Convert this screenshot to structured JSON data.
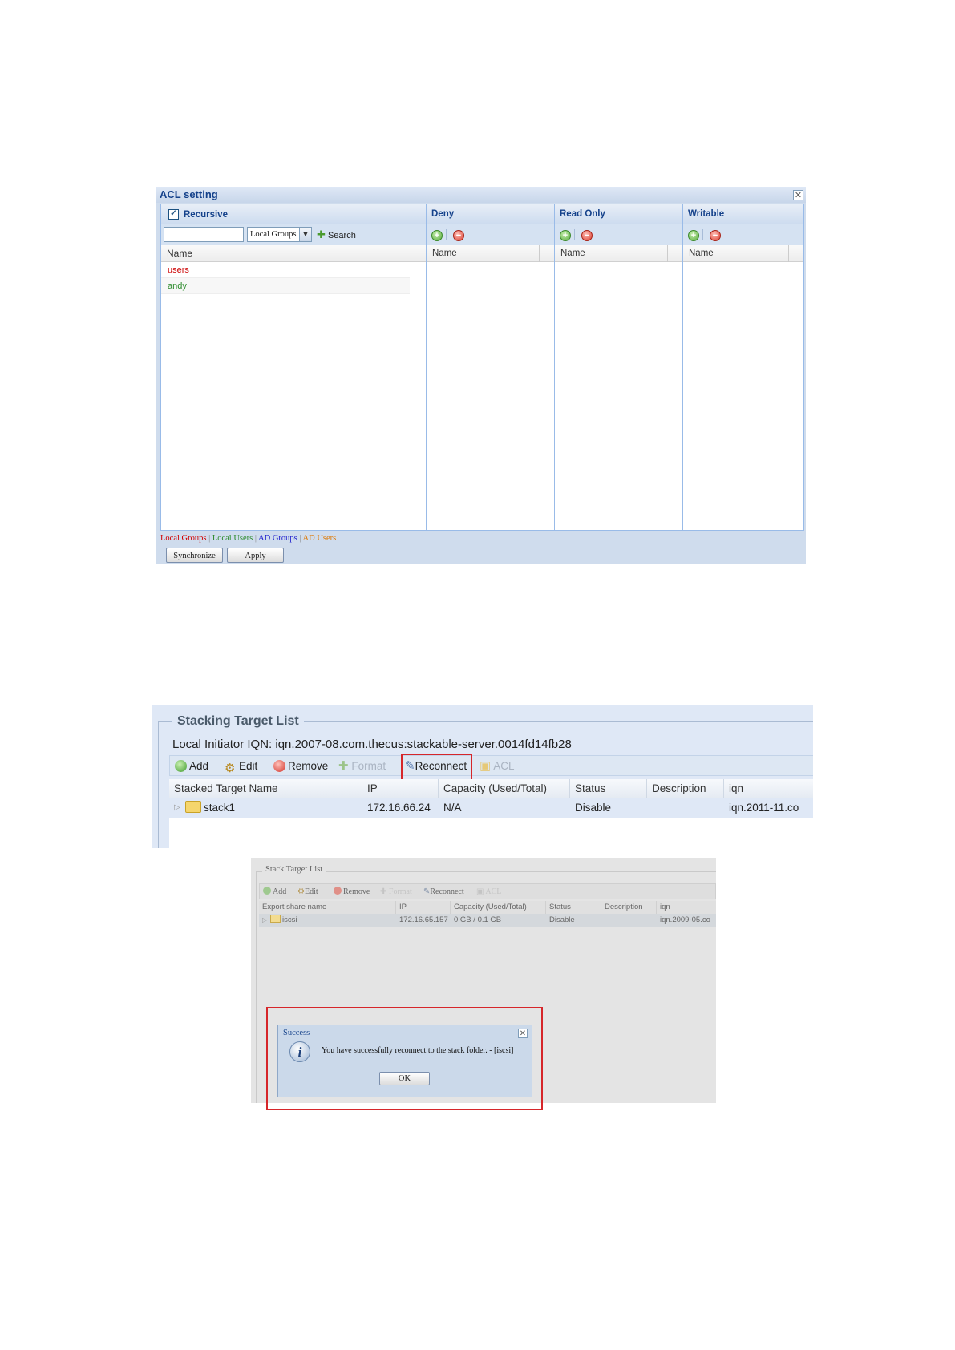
{
  "acl": {
    "title": "ACL setting",
    "recursive_label": "Recursive",
    "recursive_checked": true,
    "search_value": "",
    "filter_selected": "Local Groups",
    "search_label": "Search",
    "name_header": "Name",
    "entries": [
      {
        "name": "users",
        "color": "#cc0000"
      },
      {
        "name": "andy",
        "color": "#2a8a2a"
      }
    ],
    "panels": [
      {
        "title": "Deny",
        "column": "Name"
      },
      {
        "title": "Read Only",
        "column": "Name"
      },
      {
        "title": "Writable",
        "column": "Name"
      }
    ],
    "legend": {
      "local_groups": "Local Groups",
      "local_users": "Local Users",
      "ad_groups": "AD Groups",
      "ad_users": "AD Users",
      "separator": "|",
      "colors": {
        "local_groups": "#d00000",
        "local_users": "#2a8a2a",
        "ad_groups": "#1a1acc",
        "ad_users": "#e07800"
      }
    },
    "buttons": {
      "synchronize": "Synchronize",
      "apply": "Apply"
    }
  },
  "stacking": {
    "title": "Stacking Target List",
    "iqn_text": "Local Initiator IQN: iqn.2007-08.com.thecus:stackable-server.0014fd14fb28",
    "toolbar": {
      "add": "Add",
      "edit": "Edit",
      "remove": "Remove",
      "format": "Format",
      "reconnect": "Reconnect",
      "acl": "ACL"
    },
    "headers": [
      "Stacked Target Name",
      "IP",
      "Capacity (Used/Total)",
      "Status",
      "Description",
      "iqn"
    ],
    "row": {
      "name": "stack1",
      "ip": "172.16.66.24",
      "capacity": "N/A",
      "status": "Disable",
      "description": "",
      "iqn": "iqn.2011-11.co"
    },
    "highlight_color": "#d6262a"
  },
  "stack_small": {
    "title": "Stack Target List",
    "toolbar": {
      "add": "Add",
      "edit": "Edit",
      "remove": "Remove",
      "format": "Format",
      "reconnect": "Reconnect",
      "acl": "ACL"
    },
    "headers": [
      "Export share name",
      "IP",
      "Capacity (Used/Total)",
      "Status",
      "Description",
      "iqn"
    ],
    "row": {
      "name": "iscsi",
      "ip": "172.16.65.157",
      "capacity": "0 GB / 0.1 GB",
      "status": "Disable",
      "description": "",
      "iqn": "iqn.2009-05.co"
    }
  },
  "success_dialog": {
    "title": "Success",
    "message": "You have successfully reconnect to the stack folder. - [iscsi]",
    "ok": "OK",
    "icon": "info-icon"
  }
}
